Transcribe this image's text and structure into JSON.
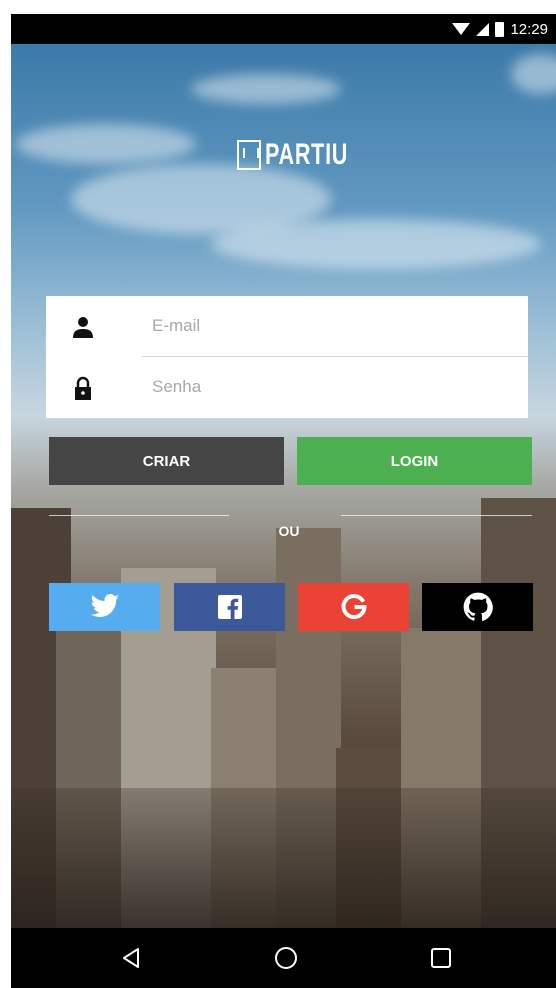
{
  "status_bar": {
    "time": "12:29",
    "icons": [
      "wifi-icon",
      "signal-icon",
      "battery-icon"
    ]
  },
  "logo": {
    "text": "PARTIU"
  },
  "form": {
    "email_placeholder": "E-mail",
    "email_icon": "user-icon",
    "password_placeholder": "Senha",
    "password_icon": "lock-icon"
  },
  "actions": {
    "criar_label": "CRIAR",
    "login_label": "LOGIN"
  },
  "divider_text": "OU",
  "social": [
    {
      "name": "twitter",
      "icon": "twitter-icon",
      "color": "#55acee"
    },
    {
      "name": "facebook",
      "icon": "facebook-icon",
      "color": "#3b5998"
    },
    {
      "name": "google",
      "icon": "google-icon",
      "color": "#ea4335"
    },
    {
      "name": "github",
      "icon": "github-icon",
      "color": "#000000"
    }
  ],
  "nav_bar": {
    "icons": [
      "back-icon",
      "home-icon",
      "recents-icon"
    ]
  },
  "colors": {
    "criar_button": "#454545",
    "login_button": "#4caf50"
  }
}
